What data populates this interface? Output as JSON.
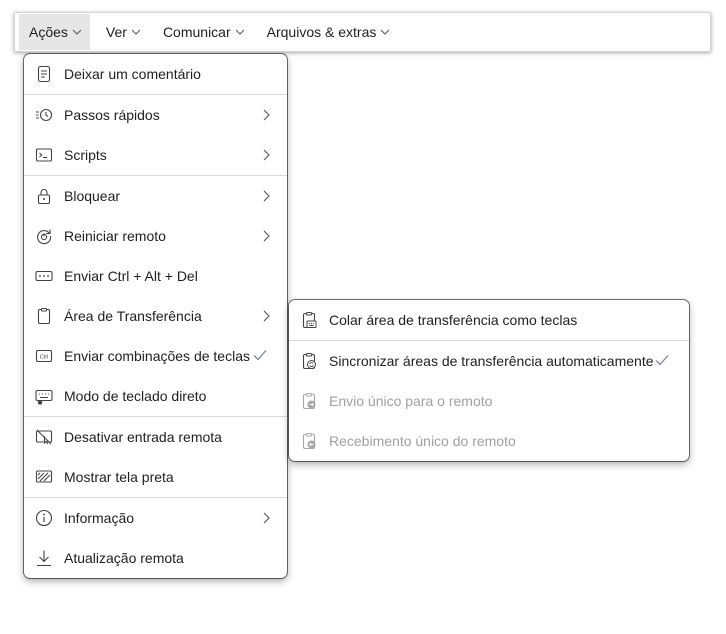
{
  "menubar": {
    "items": [
      {
        "label": "Ações"
      },
      {
        "label": "Ver"
      },
      {
        "label": "Comunicar"
      },
      {
        "label": "Arquivos & extras"
      }
    ]
  },
  "actions_menu": {
    "items": [
      {
        "label": "Deixar um comentário",
        "icon": "comment-note-icon"
      },
      {
        "label": "Passos rápidos",
        "icon": "quick-steps-icon",
        "submenu": true
      },
      {
        "label": "Scripts",
        "icon": "terminal-icon",
        "submenu": true
      },
      {
        "label": "Bloquear",
        "icon": "lock-icon",
        "submenu": true
      },
      {
        "label": "Reiniciar remoto",
        "icon": "restart-icon",
        "submenu": true
      },
      {
        "label": "Enviar Ctrl + Alt + Del",
        "icon": "keyboard-icon"
      },
      {
        "label": "Área de Transferência",
        "icon": "clipboard-icon",
        "submenu": true
      },
      {
        "label": "Enviar combinações de teclas",
        "icon": "ctrl-key-icon",
        "checked": true
      },
      {
        "label": "Modo de teclado direto",
        "icon": "direct-keyboard-icon"
      },
      {
        "label": "Desativar entrada remota",
        "icon": "disable-input-icon"
      },
      {
        "label": "Mostrar tela preta",
        "icon": "black-screen-icon"
      },
      {
        "label": "Informação",
        "icon": "info-icon",
        "submenu": true
      },
      {
        "label": "Atualização remota",
        "icon": "download-icon"
      }
    ]
  },
  "clipboard_submenu": {
    "items": [
      {
        "label": "Colar área de transferência como teclas",
        "icon": "clipboard-keys-icon"
      },
      {
        "label": "Sincronizar áreas de transferência automaticamente",
        "icon": "clipboard-sync-icon",
        "checked": true
      },
      {
        "label": "Envio único para o remoto",
        "icon": "clipboard-send-icon",
        "disabled": true
      },
      {
        "label": "Recebimento único do remoto",
        "icon": "clipboard-receive-icon",
        "disabled": true
      }
    ]
  },
  "colors": {
    "check": "#6b7f99",
    "text": "#1f1f1f",
    "disabled_text": "#a0a0a0",
    "active_menubar_bg": "#e6e6e6"
  }
}
